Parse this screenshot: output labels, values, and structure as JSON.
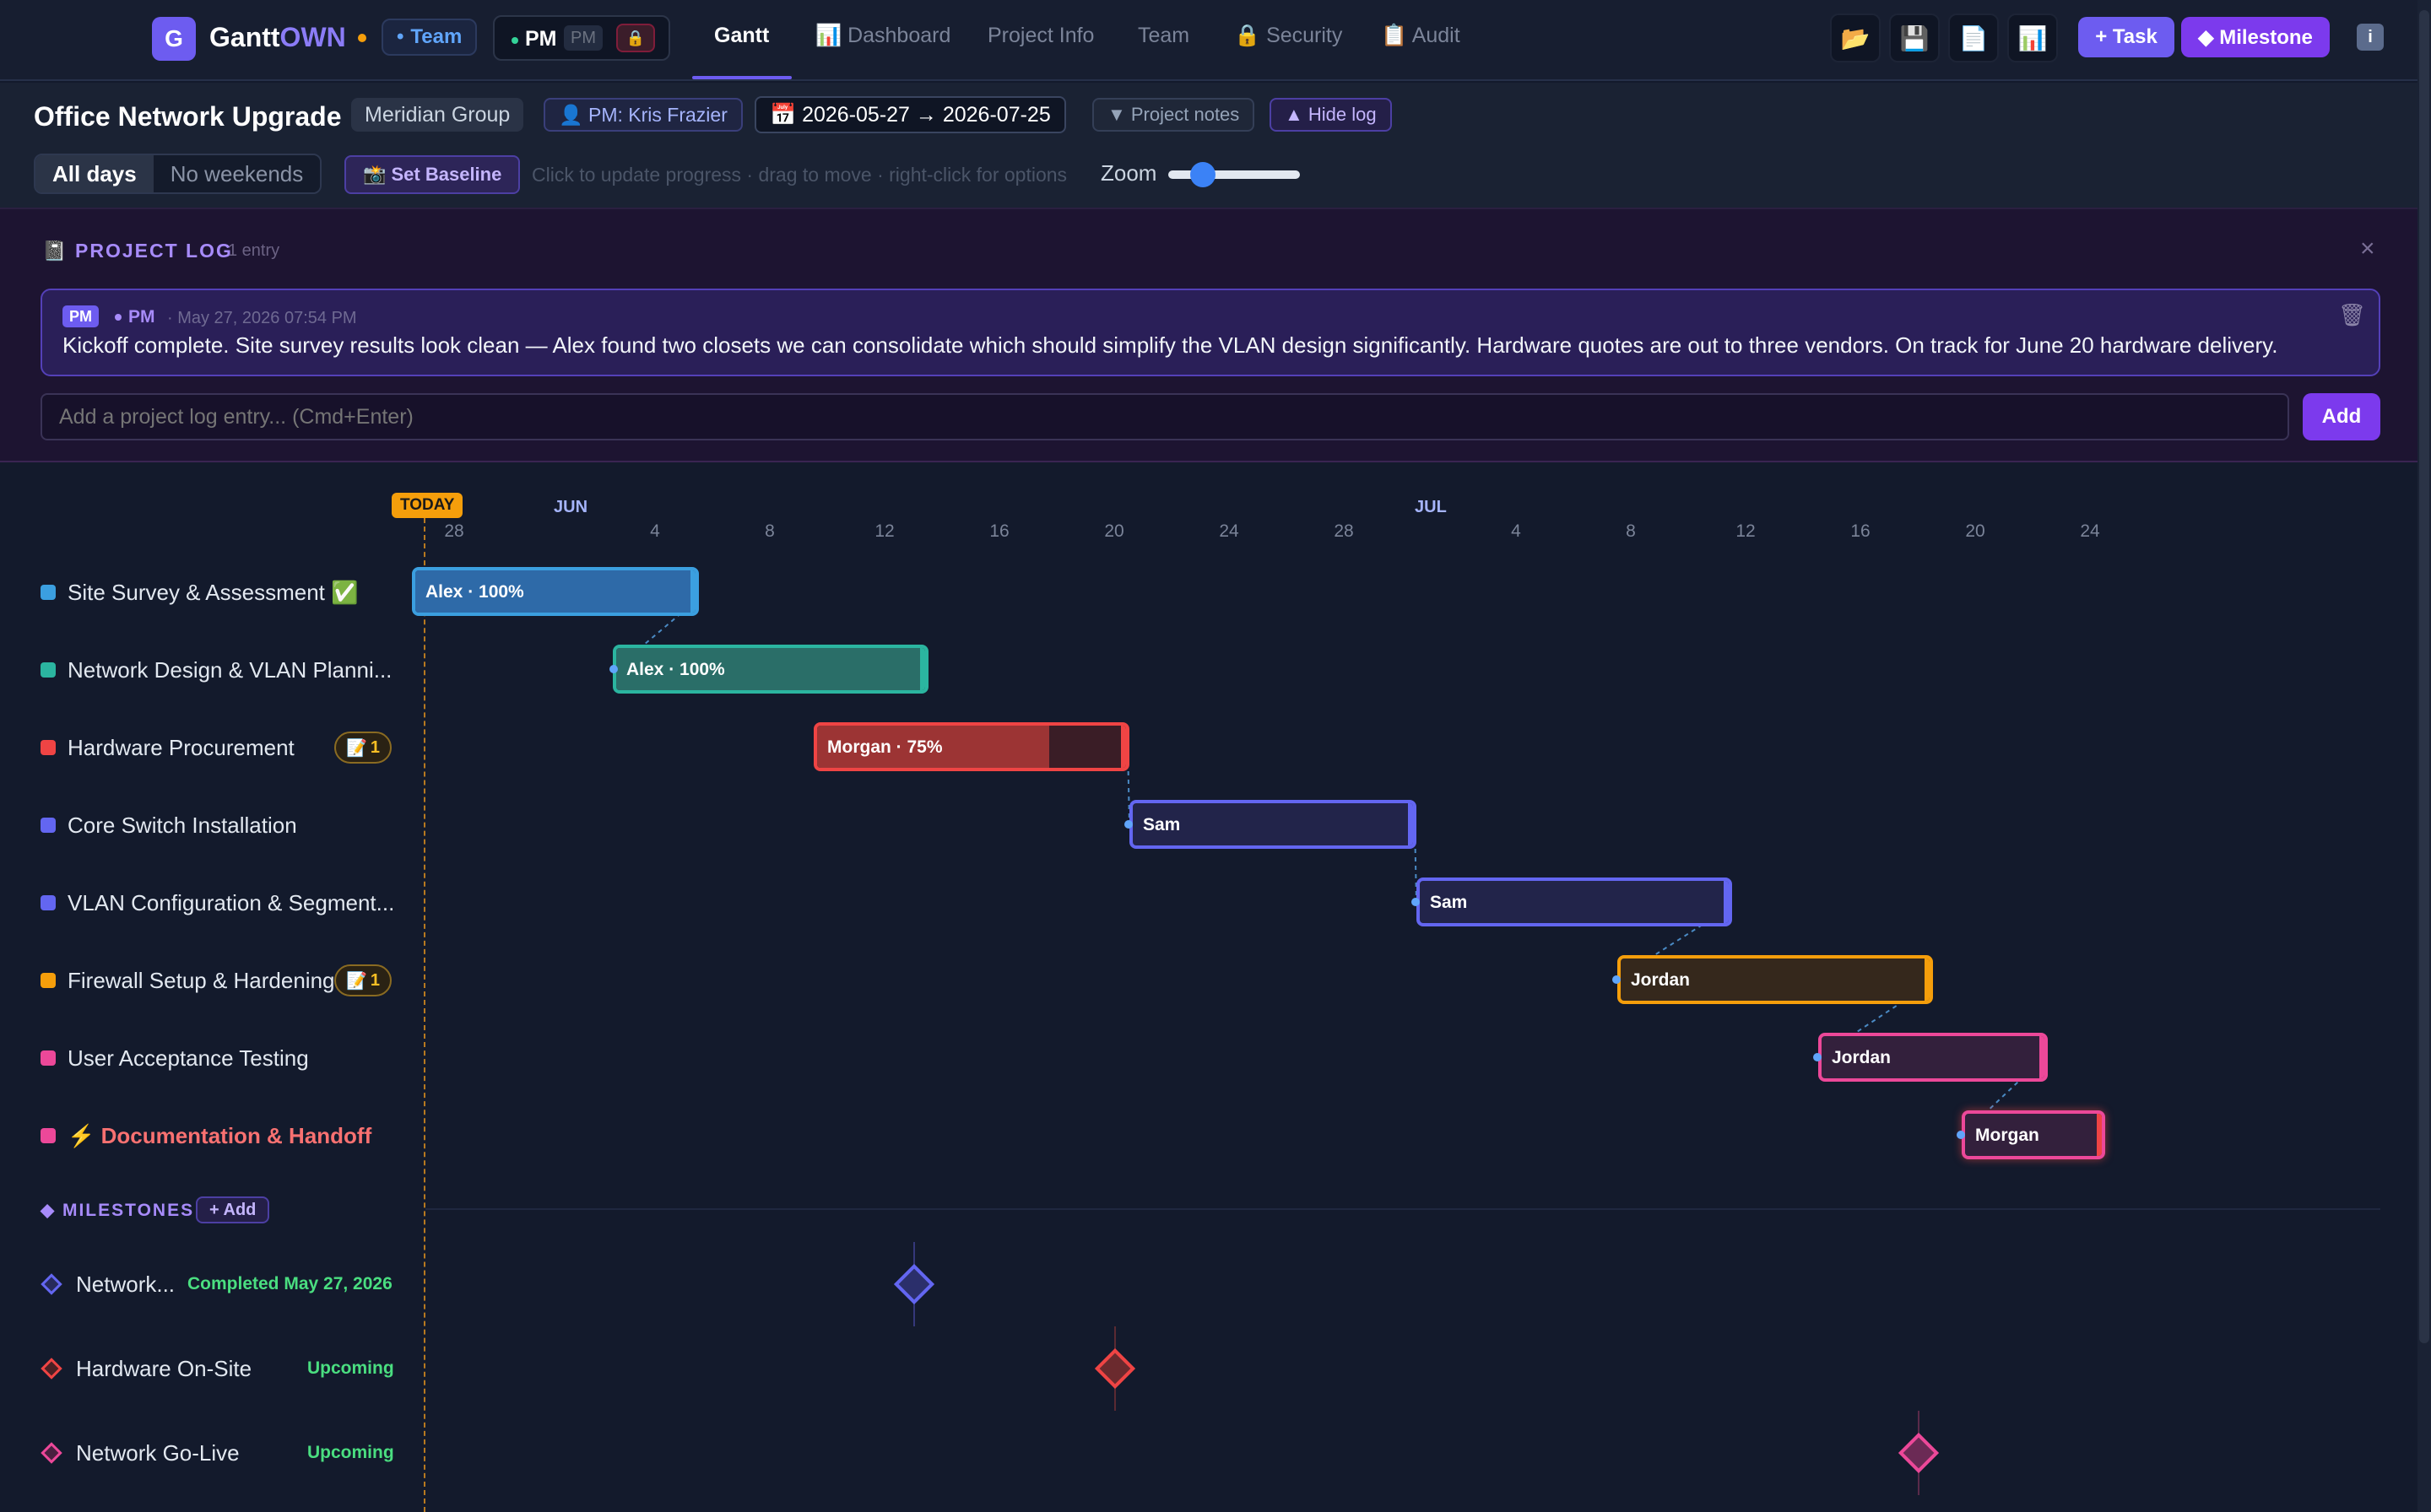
{
  "app": {
    "logo_letter": "G",
    "brand_main": "Gantt",
    "brand_accent": "OWN",
    "team_label": "Team",
    "pm_label": "PM",
    "pm_alt": "PM",
    "lock_icon": "🔒"
  },
  "nav": {
    "tabs": [
      {
        "label": "Gantt"
      },
      {
        "label": "📊 Dashboard"
      },
      {
        "label": "Project Info"
      },
      {
        "label": "Team"
      },
      {
        "label": "🔒 Security"
      },
      {
        "label": "📋 Audit"
      }
    ]
  },
  "toolbar": {
    "open_icon": "📂",
    "save_icon": "💾",
    "export_icon": "📄",
    "report_icon": "📊",
    "task_label": "+ Task",
    "milestone_label": "◆ Milestone",
    "info_icon": "i"
  },
  "project": {
    "title": "Office Network Upgrade",
    "client": "Meridian Group",
    "pm": "👤 PM: Kris Frazier",
    "dates": "📅 2026-05-27 → 2026-07-25",
    "notes_label": "▼ Project notes",
    "hide_log_label": "▲ Hide log",
    "view_all": "All days",
    "view_no_weekends": "No weekends",
    "baseline_label": "📸 Set Baseline",
    "hint": "Click to update progress · drag to move · right-click for options",
    "zoom_label": "Zoom",
    "zoom_level": 0.25
  },
  "log": {
    "title": "📓 PROJECT LOG",
    "count": "1 entry",
    "close_icon": "×",
    "entry": {
      "badge": "PM",
      "author": "PM",
      "time": "· May 27, 2026 07:54 PM",
      "text": "Kickoff complete. Site survey results look clean — Alex found two closets we can consolidate which should simplify the VLAN design significantly. Hardware quotes are out to three vendors. On track for June 20 hardware delivery.",
      "trash_icon": "🗑"
    },
    "input_placeholder": "Add a project log entry... (Cmd+Enter)",
    "add_label": "Add"
  },
  "timeline": {
    "today_label": "TODAY",
    "months": [
      "JUN",
      "JUL"
    ],
    "ticks": [
      "28",
      "4",
      "8",
      "12",
      "16",
      "20",
      "24",
      "28",
      "4",
      "8",
      "12",
      "16",
      "20",
      "24"
    ]
  },
  "tasks": [
    {
      "name": "Site Survey & Assessment ✅",
      "color": "#3b9fe0",
      "bar_label": "Alex · 100%",
      "progress": 100
    },
    {
      "name": "Network Design & VLAN Planni...",
      "color": "#2bb5a0",
      "bar_label": "Alex · 100%",
      "progress": 100
    },
    {
      "name": "Hardware Procurement",
      "color": "#ef4444",
      "bar_label": "Morgan · 75%",
      "progress": 75,
      "notes": "1"
    },
    {
      "name": "Core Switch Installation",
      "color": "#6366f1",
      "bar_label": "Sam",
      "progress": 0
    },
    {
      "name": "VLAN Configuration & Segment...",
      "color": "#6366f1",
      "bar_label": "Sam",
      "progress": 0
    },
    {
      "name": "Firewall Setup & Hardening",
      "color": "#f59e0b",
      "bar_label": "Jordan",
      "progress": 0,
      "notes": "1"
    },
    {
      "name": "User Acceptance Testing",
      "color": "#ec4899",
      "bar_label": "Jordan",
      "progress": 0
    },
    {
      "name": "⚡ Documentation & Handoff",
      "color": "#ec4899",
      "bar_label": "Morgan",
      "progress": 0,
      "critical": true
    }
  ],
  "note_icon": "📝",
  "milestones": {
    "title": "◆ MILESTONES",
    "add_label": "+ Add",
    "items": [
      {
        "name": "Network...",
        "status": "Completed May 27, 2026",
        "color": "#6366f1"
      },
      {
        "name": "Hardware On-Site",
        "status": "Upcoming",
        "color": "#ef4444"
      },
      {
        "name": "Network Go-Live",
        "status": "Upcoming",
        "color": "#ec4899"
      }
    ]
  }
}
